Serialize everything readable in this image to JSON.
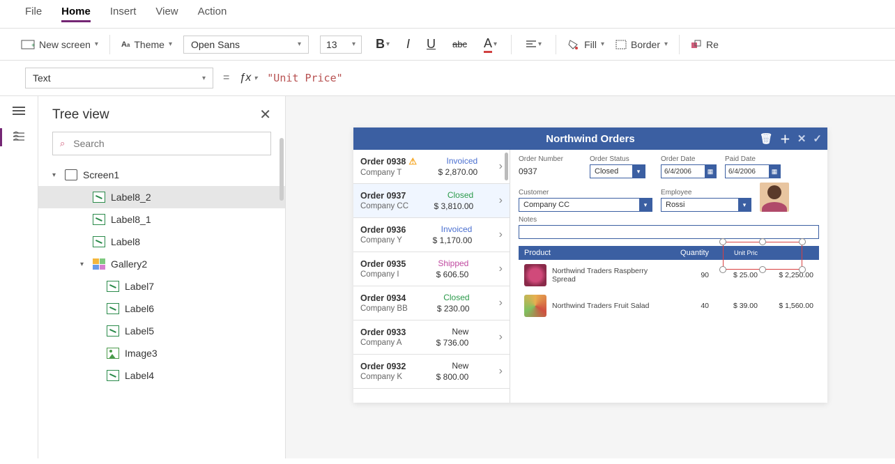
{
  "menu": {
    "items": [
      "File",
      "Home",
      "Insert",
      "View",
      "Action"
    ],
    "active": "Home"
  },
  "toolbar": {
    "new_screen": "New screen",
    "theme": "Theme",
    "font": "Open Sans",
    "font_size": "13",
    "fill": "Fill",
    "border": "Border",
    "reorder": "Re"
  },
  "formula": {
    "property": "Text",
    "value": "\"Unit Price\""
  },
  "sidebar": {
    "title": "Tree view",
    "search_placeholder": "Search",
    "items": [
      {
        "label": "Screen1",
        "icon": "screen",
        "indent": 0,
        "caret": "▾"
      },
      {
        "label": "Label8_2",
        "icon": "label",
        "indent": 2,
        "selected": true
      },
      {
        "label": "Label8_1",
        "icon": "label",
        "indent": 2
      },
      {
        "label": "Label8",
        "icon": "label",
        "indent": 2
      },
      {
        "label": "Gallery2",
        "icon": "gallery",
        "indent": 2,
        "caret": "▾"
      },
      {
        "label": "Label7",
        "icon": "label",
        "indent": 3
      },
      {
        "label": "Label6",
        "icon": "label",
        "indent": 3
      },
      {
        "label": "Label5",
        "icon": "label",
        "indent": 3
      },
      {
        "label": "Image3",
        "icon": "image",
        "indent": 3
      },
      {
        "label": "Label4",
        "icon": "label",
        "indent": 3
      }
    ]
  },
  "app": {
    "title": "Northwind Orders",
    "orders": [
      {
        "name": "Order 0938",
        "company": "Company T",
        "status": "Invoiced",
        "status_cls": "st-invoiced",
        "amount": "$ 2,870.00",
        "warn": true
      },
      {
        "name": "Order 0937",
        "company": "Company CC",
        "status": "Closed",
        "status_cls": "st-closed",
        "amount": "$ 3,810.00",
        "sel": true
      },
      {
        "name": "Order 0936",
        "company": "Company Y",
        "status": "Invoiced",
        "status_cls": "st-invoiced",
        "amount": "$ 1,170.00"
      },
      {
        "name": "Order 0935",
        "company": "Company I",
        "status": "Shipped",
        "status_cls": "st-shipped",
        "amount": "$ 606.50"
      },
      {
        "name": "Order 0934",
        "company": "Company BB",
        "status": "Closed",
        "status_cls": "st-closed",
        "amount": "$ 230.00"
      },
      {
        "name": "Order 0933",
        "company": "Company A",
        "status": "New",
        "status_cls": "st-new",
        "amount": "$ 736.00"
      },
      {
        "name": "Order 0932",
        "company": "Company K",
        "status": "New",
        "status_cls": "st-new",
        "amount": "$ 800.00"
      }
    ],
    "detail": {
      "order_number_lbl": "Order Number",
      "order_number": "0937",
      "order_status_lbl": "Order Status",
      "order_status": "Closed",
      "order_date_lbl": "Order Date",
      "order_date": "6/4/2006",
      "paid_date_lbl": "Paid Date",
      "paid_date": "6/4/2006",
      "customer_lbl": "Customer",
      "customer": "Company CC",
      "employee_lbl": "Employee",
      "employee": "Rossi",
      "notes_lbl": "Notes",
      "col_product": "Product",
      "col_quantity": "Quantity",
      "col_unit": "Unit Pric",
      "col_ext": "",
      "products": [
        {
          "name": "Northwind Traders Raspberry Spread",
          "qty": "90",
          "unit": "$ 25.00",
          "ext": "$ 2,250.00",
          "img": "pi1"
        },
        {
          "name": "Northwind Traders Fruit Salad",
          "qty": "40",
          "unit": "$ 39.00",
          "ext": "$ 1,560.00",
          "img": "pi2"
        }
      ]
    }
  }
}
